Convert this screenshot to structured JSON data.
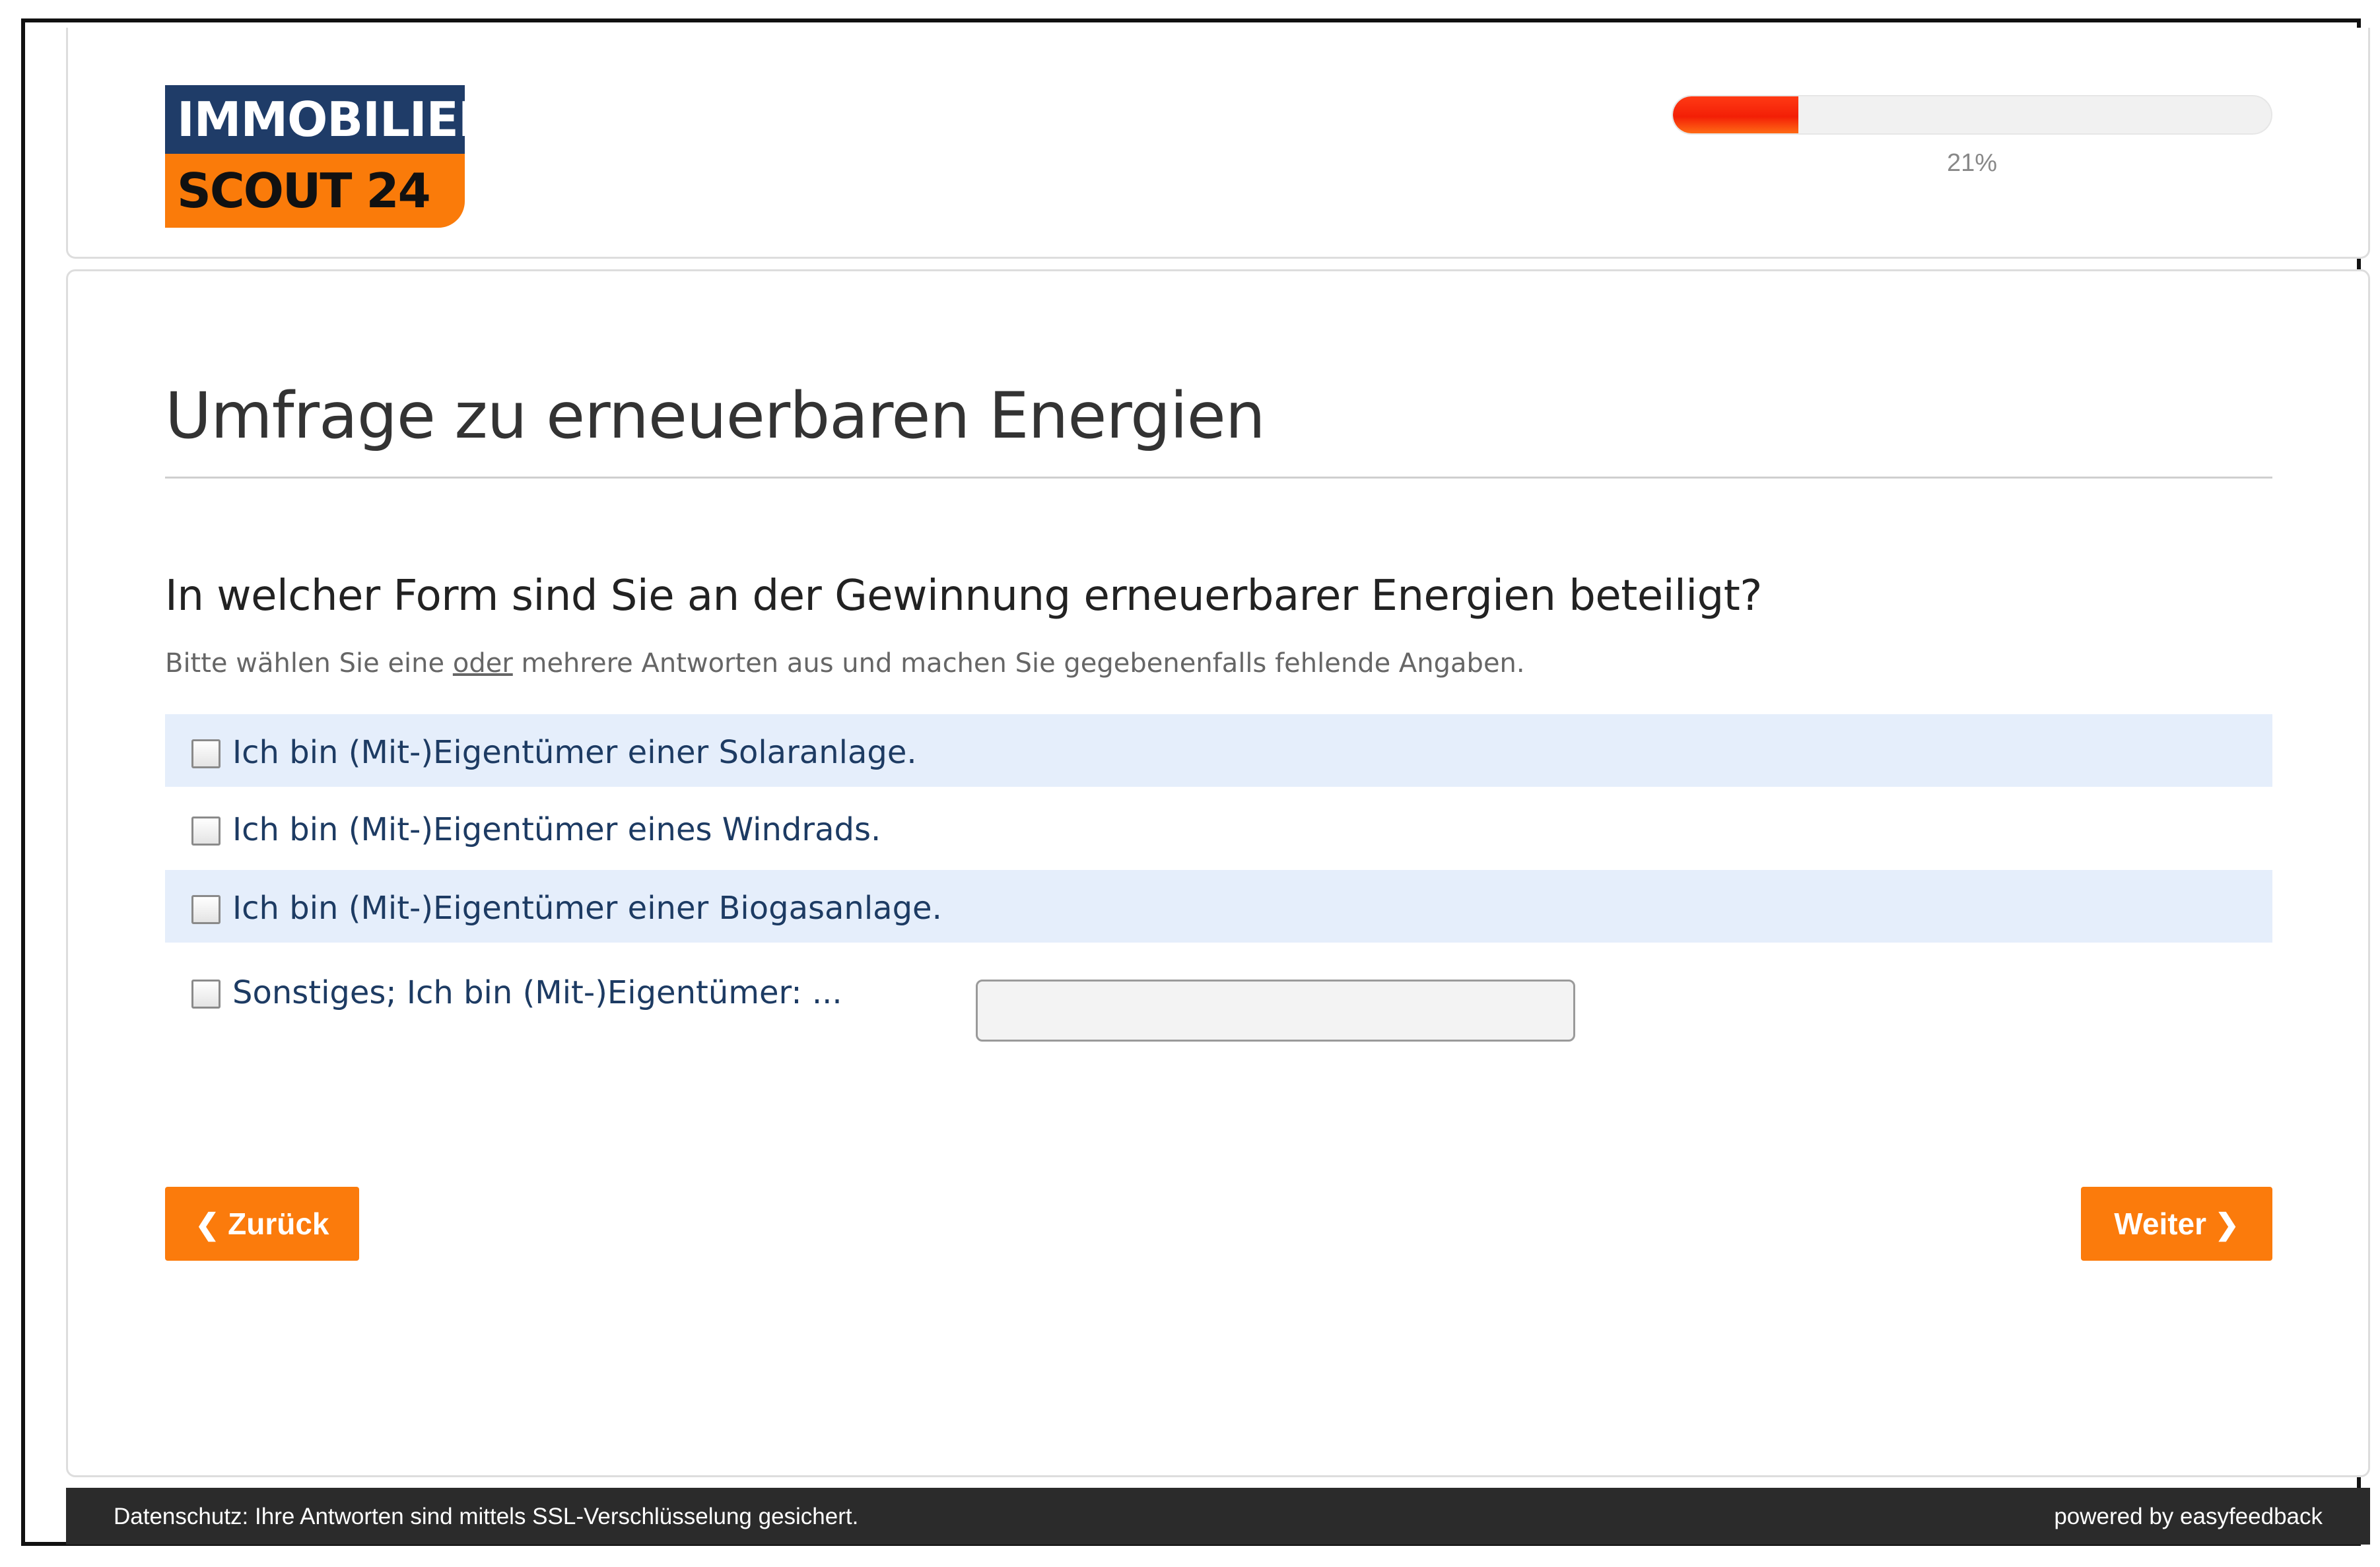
{
  "logo": {
    "line1": "IMMOBILIEN",
    "line2": "SCOUT 24"
  },
  "progress": {
    "value": 0.21,
    "label": "21%",
    "color": "#f31f06"
  },
  "survey": {
    "title": "Umfrage zu erneuerbaren Energien",
    "question": "In welcher Form sind Sie an der Gewinnung erneuerbarer Energien beteiligt?",
    "hint_before": "Bitte wählen Sie eine ",
    "hint_underlined": "oder",
    "hint_after": " mehrere Antworten aus und machen Sie gegebenenfalls fehlende Angaben."
  },
  "options": [
    {
      "label": "Ich bin (Mit-)Eigentümer einer Solaranlage.",
      "checked": false
    },
    {
      "label": "Ich bin (Mit-)Eigentümer eines Windrads.",
      "checked": false
    },
    {
      "label": "Ich bin (Mit-)Eigentümer einer Biogasanlage.",
      "checked": false
    },
    {
      "label": "Sonstiges; Ich bin (Mit-)Eigentümer: ...",
      "checked": false,
      "input_value": ""
    }
  ],
  "nav": {
    "back_label": "Zurück",
    "back_icon": "chevron-left-icon",
    "next_label": "Weiter",
    "next_icon": "chevron-right-icon"
  },
  "footer": {
    "privacy": "Datenschutz: Ihre Antworten sind mittels SSL-Verschlüsselung gesichert.",
    "powered_by": "powered by easyfeedback"
  },
  "colors": {
    "brand_navy": "#1f3c68",
    "brand_orange": "#fb7b0c",
    "option_shade": "#e5eefb",
    "footer_bg": "#2b2b2b"
  }
}
